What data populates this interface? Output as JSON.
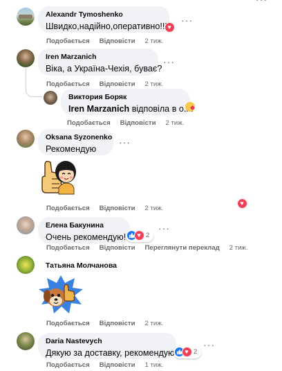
{
  "comments": [
    {
      "author": "Alexandr Tymoshenko",
      "text": "Швидко,надійно,оперативно!!!",
      "like_label": "Подобається",
      "reply_label": "Відповісти",
      "time": "2 тиж."
    },
    {
      "author": "Iren Marzanich",
      "text": "Віка, а Україна-Чехія, буває?",
      "like_label": "Подобається",
      "reply_label": "Відповісти",
      "time": "2 тиж."
    },
    {
      "author": "Виктория Боряк",
      "mention": "Iren Marzanich",
      "text": "відповіла в о.п.",
      "like_label": "Подобається",
      "reply_label": "Відповісти",
      "time": "2 тиж."
    },
    {
      "author": "Oksana Syzonenko",
      "text": "Рекомендую",
      "sticker": "thumbs-up-girl-sticker",
      "like_label": "Подобається",
      "reply_label": "Відповісти",
      "time": "2 тиж."
    },
    {
      "author": "Елена Бакунина",
      "text": "Очень рекомендую!",
      "reaction_count": "2",
      "like_label": "Подобається",
      "reply_label": "Відповісти",
      "translate_label": "Переглянути переклад",
      "time": "2 тиж."
    },
    {
      "author": "Татьяна Молчанова",
      "sticker": "puppy-thumbs-up-sticker",
      "like_label": "Подобається",
      "reply_label": "Відповісти",
      "time": "2 тиж."
    },
    {
      "author": "Daria Nastevych",
      "text": "Дякую за доставку, рекомендую.",
      "reaction_count": "2",
      "like_label": "Подобається",
      "reply_label": "Відповісти",
      "time": "1 тиж."
    }
  ],
  "more_options_glyph": "···",
  "colors": {
    "heart": "#f33e58",
    "like": "#1877f2",
    "bubble": "#f0f2f5",
    "meta": "#65676b"
  }
}
